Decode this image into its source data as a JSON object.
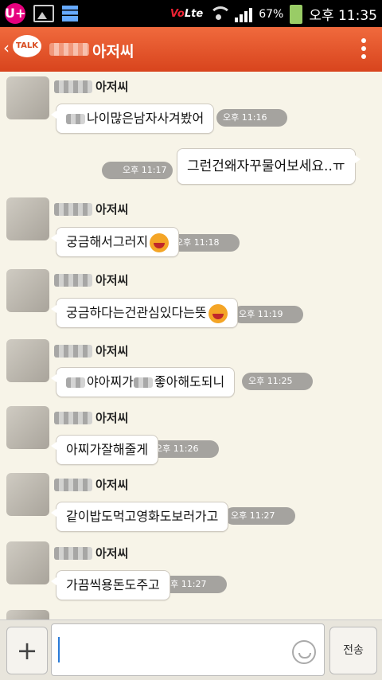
{
  "status_bar": {
    "carrier_icon": "U+",
    "network": "Vo",
    "network_suffix": "Lte",
    "battery": "67%",
    "time": "오후 11:35"
  },
  "header": {
    "back_icon": "‹",
    "logo": "TALK",
    "title": "아저씨"
  },
  "messages": [
    {
      "sender": "아저씨",
      "text": "나이많은남자사겨봤어",
      "time": "오후 11:16",
      "blur_prefix": true
    },
    {
      "outgoing": true,
      "text": "그런건왜자꾸물어보세요..ㅠ",
      "time": "오후 11:17"
    },
    {
      "sender": "아저씨",
      "text": "궁금해서그러지",
      "time": "오후 11:18",
      "emoji": "grin"
    },
    {
      "sender": "아저씨",
      "text": "궁금하다는건관심있다는뜻",
      "time": "오후 11:19",
      "emoji": "tongue"
    },
    {
      "sender": "아저씨",
      "text_a": "야아찌가",
      "text_b": "좋아해도되니",
      "time": "오후 11:25",
      "blur_prefix": true
    },
    {
      "sender": "아저씨",
      "text": "아찌가잘해줄게",
      "time": "오후 11:26"
    },
    {
      "sender": "아저씨",
      "text": "같이밥도먹고영화도보러가고",
      "time": "오후 11:27"
    },
    {
      "sender": "아저씨",
      "text": "가끔씩용돈도주고",
      "time": "오후 11:27"
    }
  ],
  "input_bar": {
    "plus_label": "+",
    "send_label": "전송"
  },
  "colors": {
    "header": "#e8582c",
    "background": "#f7f4e8",
    "time_badge": "#a5a39f"
  }
}
